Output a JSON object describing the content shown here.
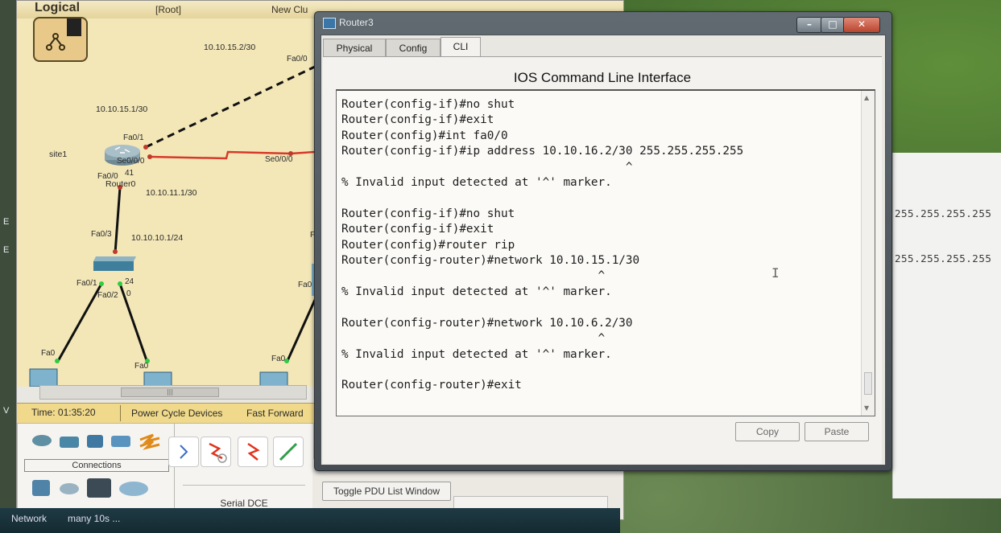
{
  "left_strip": {
    "letters": [
      "E",
      "E",
      "V"
    ]
  },
  "background_window": {
    "lines": [
      "255.255.255.255",
      "255.255.255.255"
    ]
  },
  "packet_tracer": {
    "mode": "Logical",
    "root": "[Root]",
    "new_cluster": "New Clu",
    "labels": {
      "link_top_ip": "10.10.15.2/30",
      "router_fa01_ip": "10.10.15.1/30",
      "router_fa00_ip": "10.10.11.1/30",
      "switch_link_ip": "10.10.10.1/24",
      "site": "site1",
      "router_name": "Router0"
    },
    "ports": {
      "fa00_top": "Fa0/0",
      "fa01": "Fa0/1",
      "se000": "Se0/0/0",
      "fa00": "Fa0/0",
      "port41": "41",
      "se000_remote": "Se0/0/0",
      "fa03": "Fa0/3",
      "fa01_switch": "Fa0/1",
      "fa02": "Fa0/2",
      "s24": "24",
      "s0": "0",
      "pc1": "Fa0",
      "pc2": "Fa0",
      "pc3": "Fa0",
      "right_f": "F",
      "right_fa0": "Fa0"
    },
    "time": "Time: 01:35:20",
    "power_cycle": "Power Cycle Devices",
    "fast_forward": "Fast Forward",
    "connections_label": "Connections",
    "serial_dce": "Serial DCE",
    "toggle_pdu": "Toggle PDU List Window",
    "taskbar": [
      "Network",
      "many 10s ..."
    ]
  },
  "router_window": {
    "title": "Router3",
    "tabs": [
      {
        "label": "Physical",
        "active": false
      },
      {
        "label": "Config",
        "active": false
      },
      {
        "label": "CLI",
        "active": true
      }
    ],
    "cli_title": "IOS Command Line Interface",
    "cli_lines": [
      "Router(config-if)#no shut",
      "Router(config-if)#exit",
      "Router(config)#int fa0/0",
      "Router(config-if)#ip address 10.10.16.2/30 255.255.255.255",
      "                                         ^",
      "% Invalid input detected at '^' marker.",
      "",
      "Router(config-if)#no shut",
      "Router(config-if)#exit",
      "Router(config)#router rip",
      "Router(config-router)#network 10.10.15.1/30",
      "                                     ^",
      "% Invalid input detected at '^' marker.",
      "",
      "Router(config-router)#network 10.10.6.2/30",
      "                                     ^",
      "% Invalid input detected at '^' marker.",
      "",
      "Router(config-router)#exit"
    ],
    "copy_label": "Copy",
    "paste_label": "Paste"
  }
}
